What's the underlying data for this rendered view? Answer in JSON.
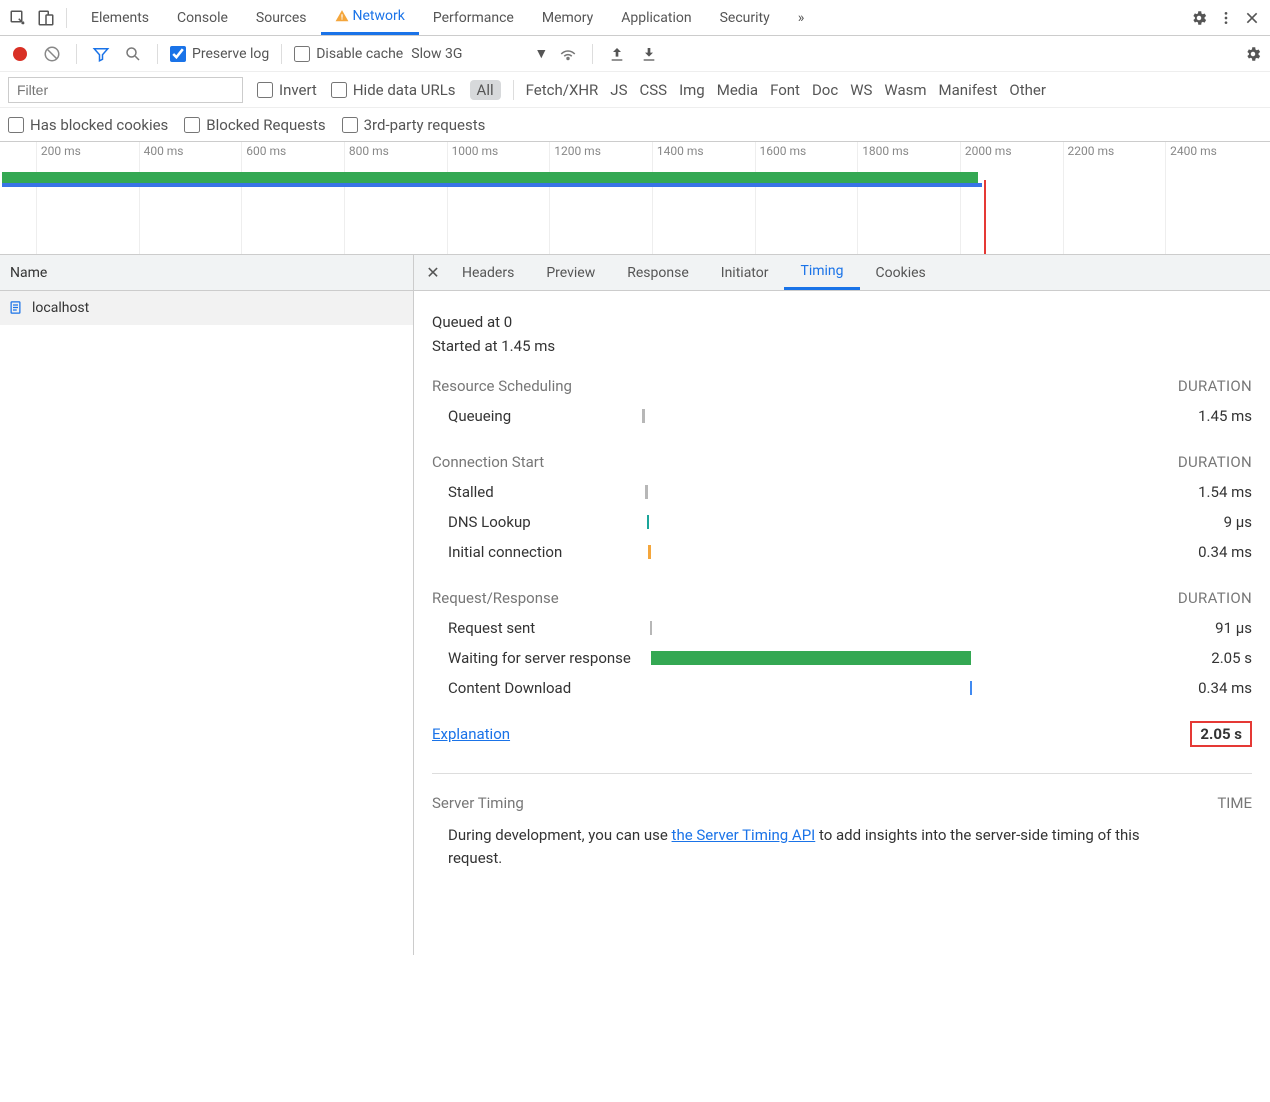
{
  "tabs": {
    "items": [
      "Elements",
      "Console",
      "Sources",
      "Network",
      "Performance",
      "Memory",
      "Application",
      "Security"
    ],
    "active": "Network",
    "overflow": "»"
  },
  "toolbar": {
    "preserve_log": "Preserve log",
    "disable_cache": "Disable cache",
    "throttle": "Slow 3G"
  },
  "filterbar": {
    "filter_placeholder": "Filter",
    "invert": "Invert",
    "hide_data_urls": "Hide data URLs",
    "types": [
      "All",
      "Fetch/XHR",
      "JS",
      "CSS",
      "Img",
      "Media",
      "Font",
      "Doc",
      "WS",
      "Wasm",
      "Manifest",
      "Other"
    ],
    "types_active": "All",
    "row2": {
      "has_blocked_cookies": "Has blocked cookies",
      "blocked_requests": "Blocked Requests",
      "third_party": "3rd-party requests"
    }
  },
  "overview": {
    "ticks": [
      "200 ms",
      "400 ms",
      "600 ms",
      "800 ms",
      "1000 ms",
      "1200 ms",
      "1400 ms",
      "1600 ms",
      "1800 ms",
      "2000 ms",
      "2200 ms",
      "2400 ms"
    ]
  },
  "request_list": {
    "header": "Name",
    "items": [
      {
        "name": "localhost"
      }
    ]
  },
  "detail_tabs": {
    "items": [
      "Headers",
      "Preview",
      "Response",
      "Initiator",
      "Timing",
      "Cookies"
    ],
    "active": "Timing"
  },
  "timing": {
    "queued": "Queued at 0",
    "started": "Started at 1.45 ms",
    "sections": [
      {
        "title": "Resource Scheduling",
        "duration_header": "DURATION",
        "rows": [
          {
            "label": "Queueing",
            "value": "1.45 ms",
            "color": "c-grey",
            "left": 0,
            "width": 0.6
          }
        ]
      },
      {
        "title": "Connection Start",
        "duration_header": "DURATION",
        "rows": [
          {
            "label": "Stalled",
            "value": "1.54 ms",
            "color": "c-grey",
            "left": 0.6,
            "width": 0.5
          },
          {
            "label": "DNS Lookup",
            "value": "9 µs",
            "color": "c-teal",
            "left": 1.0,
            "width": 0.4
          },
          {
            "label": "Initial connection",
            "value": "0.34 ms",
            "color": "c-orange",
            "left": 1.2,
            "width": 0.5
          }
        ]
      },
      {
        "title": "Request/Response",
        "duration_header": "DURATION",
        "rows": [
          {
            "label": "Request sent",
            "value": "91 µs",
            "color": "c-grey",
            "left": 1.5,
            "width": 0.4
          },
          {
            "label": "Waiting for server response",
            "value": "2.05 s",
            "color": "c-green",
            "left": 1.8,
            "width": 64
          },
          {
            "label": "Content Download",
            "value": "0.34 ms",
            "color": "c-blue",
            "left": 65.5,
            "width": 0.5
          }
        ]
      }
    ],
    "explanation": "Explanation",
    "total": "2.05 s",
    "server_timing": {
      "title": "Server Timing",
      "time_header": "TIME",
      "copy_pre": "During development, you can use ",
      "copy_link": "the Server Timing API",
      "copy_post": " to add insights into the server-side timing of this request."
    }
  }
}
